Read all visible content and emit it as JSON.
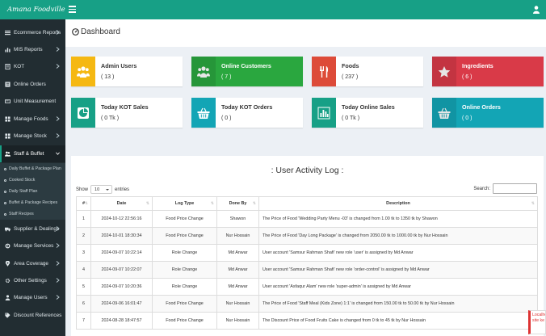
{
  "brand": "Amana Foodville",
  "colors": {
    "teal": "#17a086",
    "yellow": "#f5b812",
    "green": "#2aa73f",
    "red": "#dd4b39",
    "darkred": "#d93a48",
    "cyan": "#13a5b5",
    "sidebar": "#222d32"
  },
  "sidebar": {
    "items": [
      {
        "label": "Ecommerce Reports",
        "icon": "list-icon"
      },
      {
        "label": "MIS Reports",
        "icon": "chart-icon"
      },
      {
        "label": "KOT",
        "icon": "receipt-icon"
      },
      {
        "label": "Online Orders",
        "icon": "orders-icon"
      },
      {
        "label": "Unit Measurement",
        "icon": "ruler-icon"
      },
      {
        "label": "Manage Foods",
        "icon": "grid-icon"
      },
      {
        "label": "Manage Stock",
        "icon": "grid-icon"
      },
      {
        "label": "Staff & Buffet",
        "icon": "users-icon"
      }
    ],
    "subitems": [
      {
        "label": "Daily Buffet & Package Plan"
      },
      {
        "label": "Cooked Stock"
      },
      {
        "label": "Daily Staff Plan"
      },
      {
        "label": "Buffet & Package Recipes"
      },
      {
        "label": "Staff Recipes"
      }
    ],
    "items2": [
      {
        "label": "Supplier & Dealings",
        "icon": "truck-icon"
      },
      {
        "label": "Manage Services",
        "icon": "gear-icon"
      },
      {
        "label": "Area Coverage",
        "icon": "map-marker-icon"
      },
      {
        "label": "Other Settings",
        "icon": "cog-icon"
      },
      {
        "label": "Manage Users",
        "icon": "user-icon"
      },
      {
        "label": "Discount References",
        "icon": "tag-icon"
      }
    ]
  },
  "header": {
    "title": "Dashboard"
  },
  "cards": [
    {
      "title": "Admin Users",
      "value": "( 13 )",
      "color": "#f5b812",
      "icon": "users-icon"
    },
    {
      "title": "Online Customers",
      "value": "( 7 )",
      "color": "#2aa73f",
      "icon": "users-icon"
    },
    {
      "title": "Foods",
      "value": "( 237 )",
      "color": "#dd4b39",
      "icon": "cutlery-icon"
    },
    {
      "title": "Ingredients",
      "value": "( 6 )",
      "color": "#d93a48",
      "icon": "star-icon"
    },
    {
      "title": "Today KOT Sales",
      "value": "( 0 Tk )",
      "color": "#17a086",
      "icon": "pie-icon"
    },
    {
      "title": "Today KOT Orders",
      "value": "( 0 )",
      "color": "#13a5b5",
      "icon": "basket-icon"
    },
    {
      "title": "Today Online Sales",
      "value": "( 0 Tk )",
      "color": "#17a086",
      "icon": "bar-chart-icon"
    },
    {
      "title": "Online Orders",
      "value": "( 0 )",
      "color": "#13a5b5",
      "icon": "basket-icon"
    }
  ],
  "log": {
    "title": ": User Activity Log :",
    "show_label": "Show",
    "entries_label": "entries",
    "page_size": "10",
    "search_label": "Search:",
    "columns": [
      "#",
      "Date",
      "Log Type",
      "Done By",
      "Description"
    ],
    "rows": [
      [
        "1",
        "2024-10-12 22:56:16",
        "Food Price Change",
        "Shawon",
        "The Price of Food 'Wedding Party Menu -03' is changed from 1.00 tk to 1350 tk by Shawon"
      ],
      [
        "2",
        "2024-10-01 18:30:34",
        "Food Price Change",
        "Nur Hossain",
        "The Price of Food 'Day Long Package' is changed from 2050.00 tk to 1000.00 tk by Nur Hossain"
      ],
      [
        "3",
        "2024-09-07 10:22:14",
        "Role Change",
        "Md Anwar",
        "User account 'Samsur Rahman Shafi' new role 'user' is assigned by Md Anwar"
      ],
      [
        "4",
        "2024-09-07 10:22:07",
        "Role Change",
        "Md Anwar",
        "User account 'Samsur Rahman Shafi' new role 'order-control' is assigned by Md Anwar"
      ],
      [
        "5",
        "2024-09-07 10:20:36",
        "Role Change",
        "Md Anwar",
        "User account 'Asfaqur Alam' new role 'super-admin' is assigned by Md Anwar"
      ],
      [
        "6",
        "2024-09-06 16:01:47",
        "Food Price Change",
        "Nur Hossain",
        "The Price of Food 'Staff Meal (Kids Zone) 1:1' is changed from 150.00 tk to 50.00 tk by Nur Hossain"
      ],
      [
        "7",
        "2024-08-28 18:47:57",
        "Food Price Change",
        "Nur Hossain",
        "The Discount Price of Food Fruits Cake is changed from 0 tk to 45 tk by Nur Hossain"
      ]
    ]
  },
  "badge": {
    "line1": "Localho",
    "line2": "site ke"
  }
}
